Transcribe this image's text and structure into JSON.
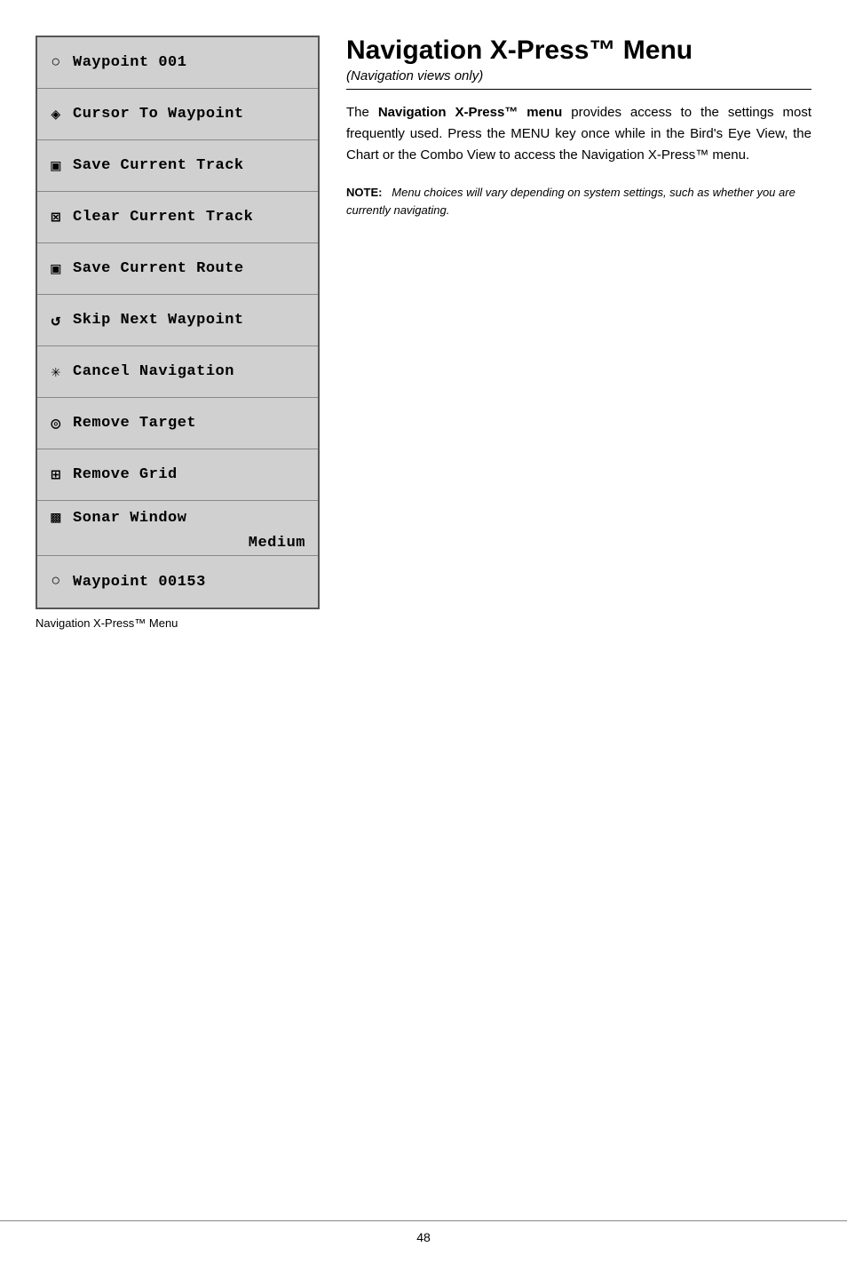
{
  "title": "Navigation X-Press™ Menu",
  "subtitle": "(Navigation views only)",
  "body_text": "The Navigation X-Press™ menu provides access to the settings most frequently used. Press the MENU key once while in the Bird's Eye View, the Chart or the Combo View to access the Navigation X-Press™ menu.",
  "note_label": "NOTE:",
  "note_text": "Menu choices will vary depending on system settings, such as whether you are currently navigating.",
  "menu_caption": "Navigation X-Press™ Menu",
  "page_number": "48",
  "menu_items": [
    {
      "id": "waypoint-001",
      "icon": "○",
      "label": "Waypoint 001"
    },
    {
      "id": "cursor-to-waypoint",
      "icon": "◇",
      "label": "Cursor To Waypoint"
    },
    {
      "id": "save-current-track",
      "icon": "▣",
      "label": "Save Current Track"
    },
    {
      "id": "clear-current-track",
      "icon": "⊠",
      "label": "Clear Current Track"
    },
    {
      "id": "save-current-route",
      "icon": "▣",
      "label": "Save Current Route"
    },
    {
      "id": "skip-next-waypoint",
      "icon": "↩",
      "label": "Skip Next Waypoint"
    },
    {
      "id": "cancel-navigation",
      "icon": "✳",
      "label": "Cancel Navigation"
    },
    {
      "id": "remove-target",
      "icon": "◎",
      "label": "Remove Target"
    },
    {
      "id": "remove-grid",
      "icon": "⊞",
      "label": "Remove Grid"
    },
    {
      "id": "sonar-window",
      "icon": "▩",
      "label": "Sonar Window",
      "sublabel": "Medium"
    },
    {
      "id": "waypoint-00153",
      "icon": "○",
      "label": "Waypoint 00153"
    }
  ]
}
